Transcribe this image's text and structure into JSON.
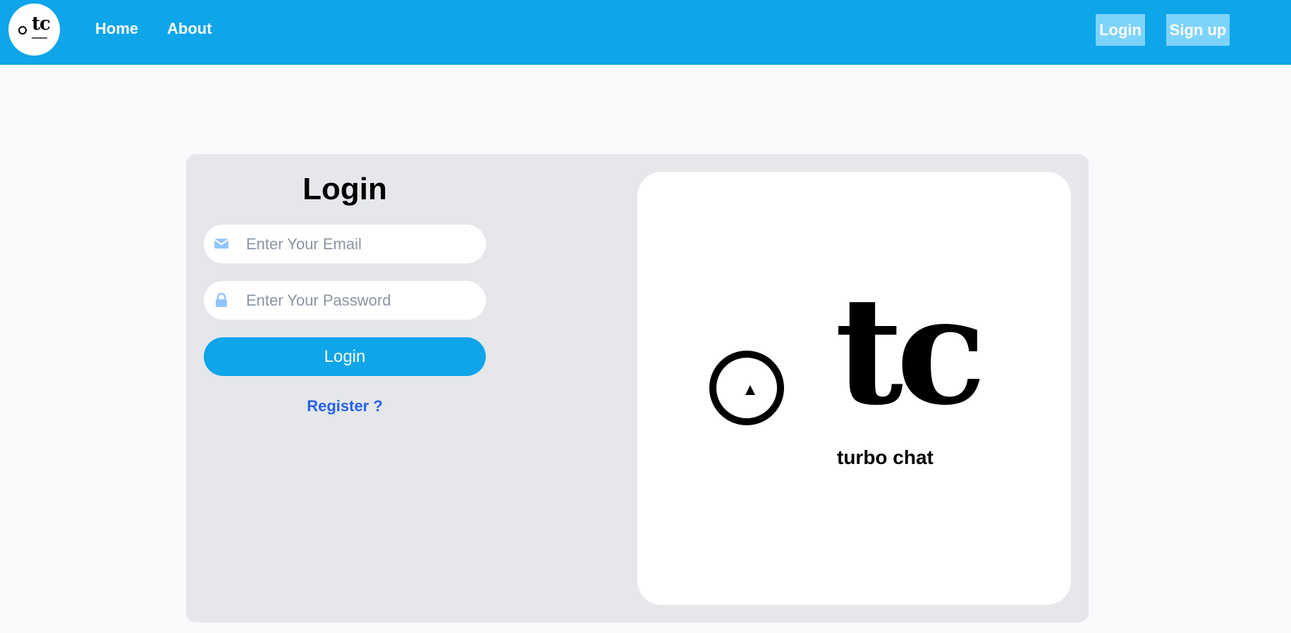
{
  "nav": {
    "logo_text": "tc",
    "links": [
      "Home",
      "About"
    ],
    "login_label": "Login",
    "signup_label": "Sign up"
  },
  "form": {
    "title": "Login",
    "email_placeholder": "Enter Your Email",
    "password_placeholder": "Enter Your Password",
    "submit_label": "Login",
    "register_label": "Register ?"
  },
  "brand": {
    "logo_text": "tc",
    "tagline": "turbo chat"
  },
  "colors": {
    "primary": "#0ea5e9",
    "nav_button": "#7dd3fc",
    "link": "#2563eb",
    "icon": "#93c5fd"
  },
  "icons": {
    "email": "envelope-icon",
    "password": "lock-icon"
  }
}
